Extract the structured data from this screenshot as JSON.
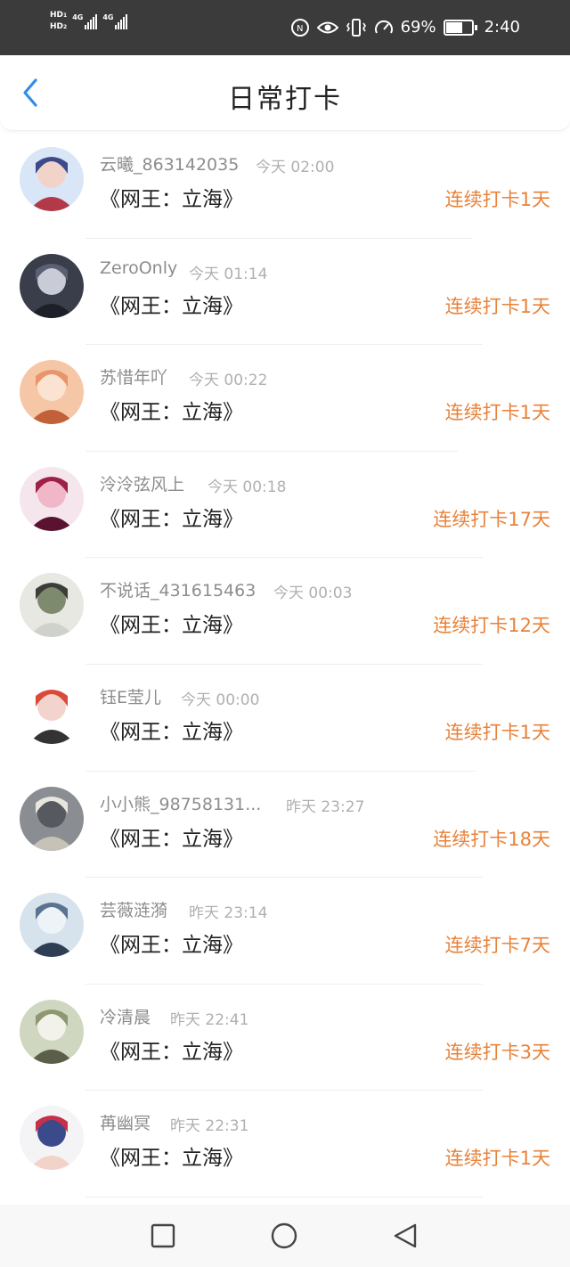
{
  "status_bar": {
    "network_left": [
      "HD",
      "HD"
    ],
    "network_sub": [
      "1",
      "2"
    ],
    "signal_labels": [
      "4G",
      "4G"
    ],
    "battery_percent": "69%",
    "battery_level": 0.69,
    "time": "2:40",
    "icons": [
      "hd-icon",
      "signal-icon",
      "nfc-icon",
      "eye-icon",
      "vibrate-icon",
      "speed-icon",
      "battery-icon"
    ]
  },
  "header": {
    "title": "日常打卡",
    "back_icon": "chevron-left-icon",
    "accent": "#2f8ee8"
  },
  "colors": {
    "streak": "#e8823a",
    "username": "#8d8d8d",
    "timestamp": "#b0b0b0",
    "title_text": "#222222"
  },
  "entries": [
    {
      "username": "云曦_863142035",
      "time": "今天 02:00",
      "work": "《网王：立海》",
      "streak": "连续打卡1天"
    },
    {
      "username": "ZeroOnly",
      "time": "今天 01:14",
      "work": "《网王：立海》",
      "streak": "连续打卡1天"
    },
    {
      "username": "苏惜年吖",
      "time": "今天 00:22",
      "work": "《网王：立海》",
      "streak": "连续打卡1天"
    },
    {
      "username": "泠泠弦风上",
      "time": "今天 00:18",
      "work": "《网王：立海》",
      "streak": "连续打卡17天"
    },
    {
      "username": "不说话_431615463",
      "time": "今天 00:03",
      "work": "《网王：立海》",
      "streak": "连续打卡12天"
    },
    {
      "username": "钰E莹儿",
      "time": "今天 00:00",
      "work": "《网王：立海》",
      "streak": "连续打卡1天"
    },
    {
      "username": "小小熊_98758131...",
      "time": "昨天 23:27",
      "work": "《网王：立海》",
      "streak": "连续打卡18天"
    },
    {
      "username": "芸薇涟漪",
      "time": "昨天 23:14",
      "work": "《网王：立海》",
      "streak": "连续打卡7天"
    },
    {
      "username": "冷清晨",
      "time": "昨天 22:41",
      "work": "《网王：立海》",
      "streak": "连续打卡3天"
    },
    {
      "username": "苒幽冥",
      "time": "昨天 22:31",
      "work": "《网王：立海》",
      "streak": "连续打卡1天"
    }
  ],
  "nav_bar": {
    "icons": [
      "recent-apps-icon",
      "home-icon",
      "back-icon"
    ]
  }
}
